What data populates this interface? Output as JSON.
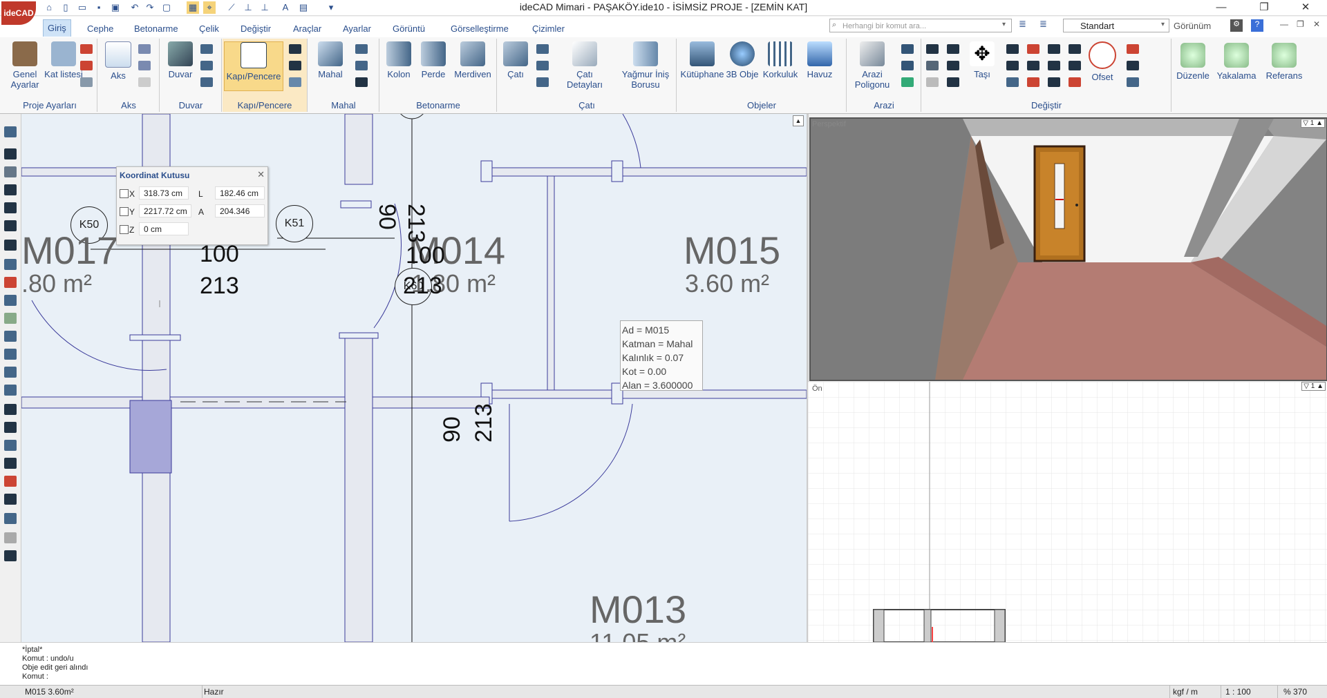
{
  "app": {
    "logo": "ideCAD",
    "title": "ideCAD Mimari - PAŞAKÖY.ide10 - İSİMSİZ PROJE - [ZEMİN KAT]"
  },
  "menu_tabs": [
    "Giriş",
    "Cephe",
    "Betonarme",
    "Çelik",
    "Değiştir",
    "Araçlar",
    "Ayarlar",
    "Görüntü",
    "Görselleştirme",
    "Çizimler"
  ],
  "search": {
    "placeholder": "Herhangi bir komut ara..."
  },
  "style_select": "Standart",
  "view_menu": "Görünüm",
  "ribbon": {
    "proje_ayarlari": {
      "label": "Proje Ayarları",
      "genel": "Genel Ayarlar",
      "kat": "Kat listesi"
    },
    "aks": {
      "label": "Aks",
      "btn": "Aks"
    },
    "duvar": {
      "label": "Duvar",
      "btn": "Duvar"
    },
    "kapi": {
      "label": "Kapı/Pencere",
      "btn": "Kapı/Pencere"
    },
    "mahal": {
      "label": "Mahal",
      "btn": "Mahal"
    },
    "betonarme": {
      "label": "Betonarme",
      "kolon": "Kolon",
      "perde": "Perde",
      "merdiven": "Merdiven"
    },
    "cati": {
      "label": "Çatı",
      "cati": "Çatı",
      "detay": "Çatı Detayları",
      "yagmur": "Yağmur İniş Borusu"
    },
    "objeler": {
      "label": "Objeler",
      "kutuphane": "Kütüphane",
      "obje3b": "3B Obje",
      "korkuluk": "Korkuluk",
      "havuz": "Havuz"
    },
    "arazi": {
      "label": "Arazi",
      "poligon": "Arazi Poligonu"
    },
    "degistir": {
      "label": "Değiştir",
      "tasi": "Taşı",
      "ofset": "Ofset"
    },
    "extra": {
      "duzenle": "Düzenle",
      "yakalama": "Yakalama",
      "referans": "Referans"
    }
  },
  "drawing": {
    "rooms": [
      {
        "name": "M017",
        "area": ".80 m²"
      },
      {
        "name": "M014",
        "area": "1.80 m²"
      },
      {
        "name": "M015",
        "area": "3.60 m²"
      },
      {
        "name": "M013",
        "area": "11.05 m²"
      }
    ],
    "columns": [
      "K50",
      "K51",
      "K60"
    ],
    "dims": {
      "a": "100",
      "b": "213",
      "c": "90",
      "d": "213",
      "e": "100",
      "f": "213",
      "g": "90",
      "h": "213"
    }
  },
  "coord_box": {
    "title": "Koordinat Kutusu",
    "x_label": "X",
    "x": "318.73 cm",
    "y_label": "Y",
    "y": "2217.72 cm",
    "z_label": "Z",
    "z": "0 cm",
    "l_label": "L",
    "l": "182.46 cm",
    "a_label": "A",
    "a": "204.346"
  },
  "tooltip": {
    "ad": "Ad = M015",
    "katman": "Katman = Mahal",
    "kalinlik": "Kalınlık = 0.07",
    "kot": "Kot = 0.00",
    "alan": "Alan = 3.600000"
  },
  "views": {
    "perspective": "Perspektif",
    "front": "Ön"
  },
  "command_log": [
    "*İptal*",
    "Komut : undo/u",
    "Obje edit geri alındı",
    "Komut :"
  ],
  "status": {
    "left": "M015 3.60m²",
    "state": "Hazır",
    "units": "kgf / m",
    "scale": "1 : 100",
    "zoom": "% 370"
  },
  "colors": {
    "accent": "#2a4e8c",
    "canvas_bg": "#e9f0f7",
    "wall_line": "#3a3a9a",
    "logo_red": "#c0392b"
  }
}
